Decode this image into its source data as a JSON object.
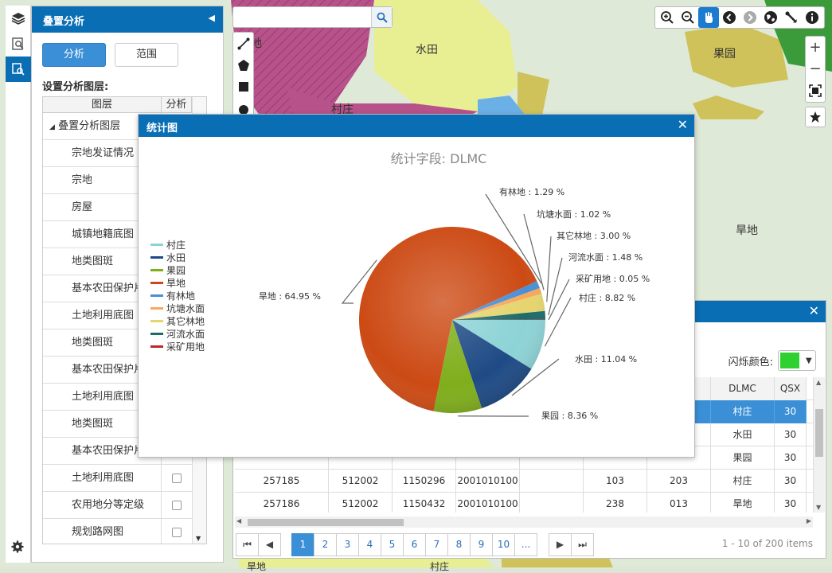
{
  "map": {
    "labels": [
      "水田",
      "果园",
      "村庄",
      "地",
      "旱地",
      "旱地",
      "村庄"
    ]
  },
  "sidebar": {
    "icons": [
      "layers-icon",
      "search-doc-icon",
      "overlay-analysis-icon"
    ],
    "settings_icon": "gear-icon"
  },
  "panel": {
    "title": "叠置分析",
    "tab_analyze": "分析",
    "tab_range": "范围",
    "section_title": "设置分析图层:",
    "col_layer": "图层",
    "col_analyze": "分析",
    "group_label": "叠置分析图层",
    "layers": [
      "宗地发证情况",
      "宗地",
      "房屋",
      "城镇地籍底图",
      "地类图斑",
      "基本农田保护片",
      "土地利用底图",
      "地类图斑",
      "基本农田保护片",
      "土地利用底图",
      "地类图斑",
      "基本农田保护片",
      "土地利用底图",
      "农用地分等定级",
      "规划路网图"
    ]
  },
  "search": {
    "placeholder": ""
  },
  "stats": {
    "title": "统计图",
    "chart_data": {
      "type": "pie",
      "title": "统计字段: DLMC",
      "slices": [
        {
          "name": "村庄",
          "value": 8.82,
          "label": "村庄 : 8.82 %",
          "color": "#8dd3d6"
        },
        {
          "name": "水田",
          "value": 11.04,
          "label": "水田 : 11.04 %",
          "color": "#1e4a85"
        },
        {
          "name": "果园",
          "value": 8.36,
          "label": "果园 : 8.36 %",
          "color": "#7fae1b"
        },
        {
          "name": "旱地",
          "value": 64.95,
          "label": "旱地 : 64.95 %",
          "color": "#cc4a14"
        },
        {
          "name": "有林地",
          "value": 1.29,
          "label": "有林地 : 1.29 %",
          "color": "#4a8fd6"
        },
        {
          "name": "坑塘水面",
          "value": 1.02,
          "label": "坑塘水面 : 1.02 %",
          "color": "#f7a85a"
        },
        {
          "name": "其它林地",
          "value": 3.0,
          "label": "其它林地 : 3.00 %",
          "color": "#e6d46e"
        },
        {
          "name": "河流水面",
          "value": 1.48,
          "label": "河流水面 : 1.48 %",
          "color": "#1b6b6b"
        },
        {
          "name": "采矿用地",
          "value": 0.05,
          "label": "采矿用地 : 0.05 %",
          "color": "#c0262d"
        }
      ],
      "legend_position": "left"
    }
  },
  "attr": {
    "flash_label": "闪烁颜色:",
    "flash_color": "#2ed12e",
    "headers": [
      "",
      "",
      "",
      "",
      "",
      "",
      "",
      "DLMC",
      "QSX"
    ],
    "rows": [
      [
        "",
        "",
        "",
        "",
        "",
        "",
        "",
        "村庄",
        "30"
      ],
      [
        "",
        "",
        "",
        "",
        "",
        "",
        "",
        "水田",
        "30"
      ],
      [
        "",
        "",
        "",
        "",
        "",
        "",
        "",
        "果园",
        "30"
      ],
      [
        "257185",
        "512002",
        "1150296",
        "2001010100",
        "",
        "103",
        "203",
        "村庄",
        "30"
      ],
      [
        "257186",
        "512002",
        "1150432",
        "2001010100",
        "",
        "238",
        "013",
        "旱地",
        "30"
      ]
    ],
    "pages": [
      "1",
      "2",
      "3",
      "4",
      "5",
      "6",
      "7",
      "8",
      "9",
      "10",
      "..."
    ],
    "page_info": "1 - 10 of 200 items"
  }
}
